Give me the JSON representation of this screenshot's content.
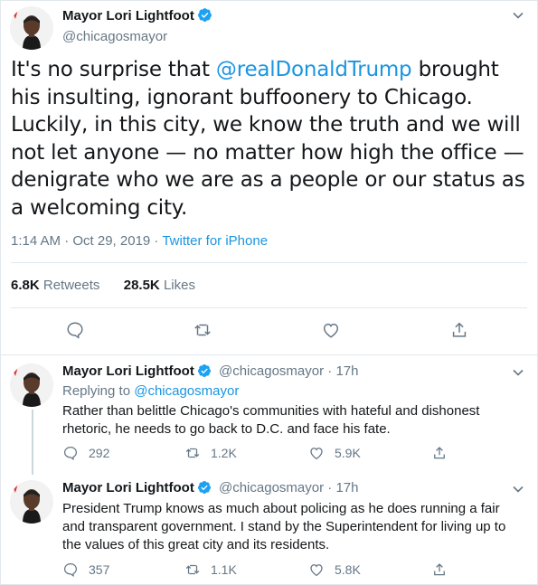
{
  "main_tweet": {
    "author_name": "Mayor Lori Lightfoot",
    "handle": "@chicagosmayor",
    "text_before": "It's no surprise that ",
    "mention": "@realDonaldTrump",
    "text_after": " brought his insulting, ignorant buffoonery to Chicago. Luckily, in this city, we know the truth and we will not let anyone — no matter how high the office — denigrate who we are as a people or our status as a welcoming city.",
    "time": "1:14 AM · Oct 29, 2019",
    "separator": " · ",
    "source": "Twitter for iPhone",
    "retweets_count": "6.8K",
    "retweets_label": "Retweets",
    "likes_count": "28.5K",
    "likes_label": "Likes"
  },
  "replies": [
    {
      "author_name": "Mayor Lori Lightfoot",
      "handle": "@chicagosmayor",
      "dot": " · ",
      "age": "17h",
      "replying_label": "Replying to ",
      "replying_to": "@chicagosmayor",
      "text": "Rather than belittle Chicago's communities with hateful and dishonest rhetoric, he needs to go back to D.C. and face his fate.",
      "reply_count": "292",
      "retweet_count": "1.2K",
      "like_count": "5.9K"
    },
    {
      "author_name": "Mayor Lori Lightfoot",
      "handle": "@chicagosmayor",
      "dot": " · ",
      "age": "17h",
      "text": "President Trump knows as much about policing as he does running a fair and transparent government. I stand by the Superintendent for living up to the values of this great city and its residents.",
      "reply_count": "357",
      "retweet_count": "1.1K",
      "like_count": "5.8K"
    }
  ],
  "icons": {
    "verified": "verified-badge-icon",
    "reply": "reply-icon",
    "retweet": "retweet-icon",
    "like": "heart-icon",
    "share": "share-icon",
    "caret": "chevron-down-icon"
  },
  "colors": {
    "link": "#1b95e0",
    "verified": "#1da1f2",
    "muted": "#657786",
    "text": "#14171a"
  }
}
